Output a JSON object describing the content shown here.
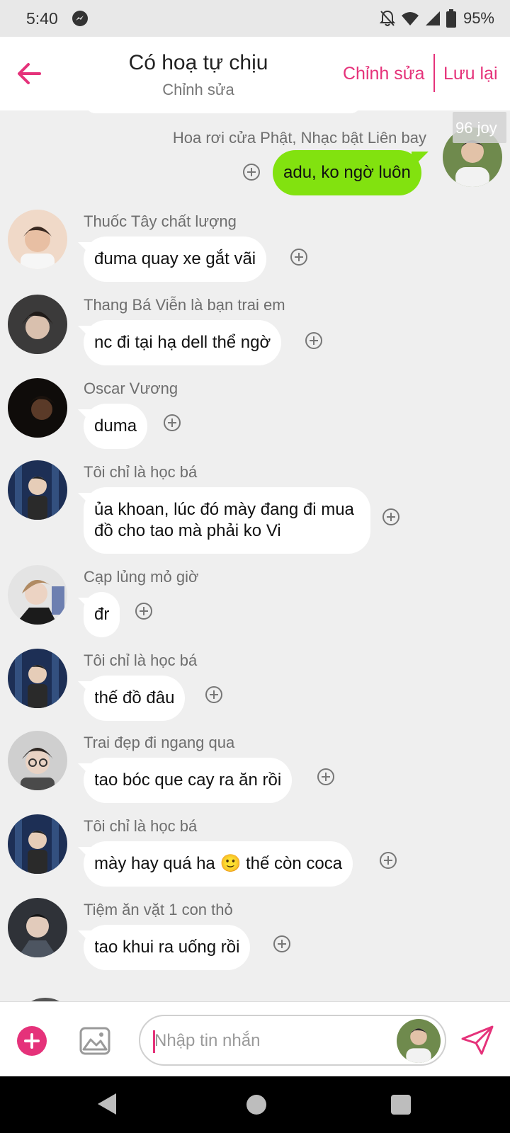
{
  "status_bar": {
    "time": "5:40",
    "battery": "95%",
    "icons": [
      "messenger-icon",
      "bell-off-icon",
      "wifi-icon",
      "signal-icon",
      "battery-icon"
    ]
  },
  "header": {
    "title": "Có hoạ tự chịu",
    "subtitle": "Chỉnh sửa",
    "edit_label": "Chỉnh sửa",
    "save_label": "Lưu lại",
    "accent_color": "#e5327a"
  },
  "messages": [
    {
      "sender": "Hoa rơi cửa Phật, Nhạc bật Liên bay",
      "text": "adu, ko ngờ luôn",
      "outgoing": true,
      "badge": "96 joy"
    },
    {
      "sender": "Thuốc Tây chất lượng",
      "text": "đuma quay xe gắt vãi"
    },
    {
      "sender": "Thang Bá Viễn là bạn trai em",
      "text": "nc đi tại hạ dell thể ngờ"
    },
    {
      "sender": "Oscar Vương",
      "text": "duma"
    },
    {
      "sender": "Tôi chỉ là học bá",
      "text": "ủa khoan, lúc đó mày đang đi mua đồ cho tao mà phải ko Vi"
    },
    {
      "sender": "Cạp lủng mỏ giờ",
      "text": "đr"
    },
    {
      "sender": "Tôi chỉ là học bá",
      "text": "thế đồ đâu"
    },
    {
      "sender": "Trai đẹp đi ngang qua",
      "text": "tao bóc que cay ra ăn rồi"
    },
    {
      "sender": "Tôi chỉ là học bá",
      "text": "mày hay quá ha 🙂 thế còn coca"
    },
    {
      "sender": "Tiệm ăn vặt 1 con thỏ",
      "text": "tao khui ra uống rồi"
    }
  ],
  "input": {
    "placeholder": "Nhập tin nhắn"
  },
  "colors": {
    "outgoing_bubble": "#82e20f",
    "incoming_bubble": "#ffffff",
    "background": "#efefef"
  }
}
